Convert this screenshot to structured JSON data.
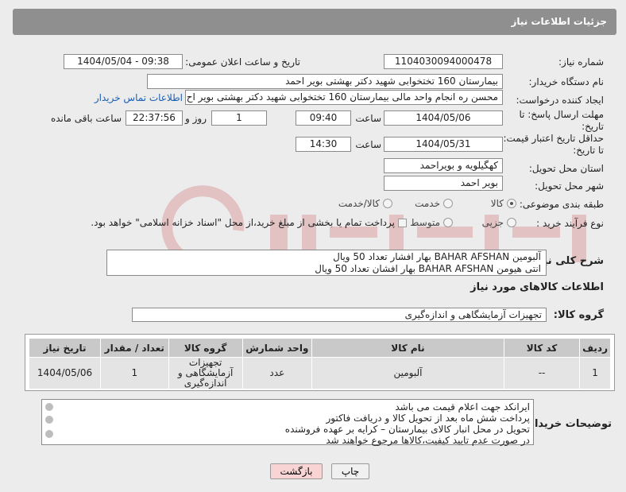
{
  "header": {
    "title": "جزئیات اطلاعات نیاز"
  },
  "labels": {
    "need_number": "شماره نیاز:",
    "announce_datetime": "تاریخ و ساعت اعلان عمومی:",
    "buyer_org": "نام دستگاه خریدار:",
    "requester": "ایجاد کننده درخواست:",
    "reply_deadline_1": "مهلت ارسال پاسخ: تا",
    "reply_deadline_2": "تاریخ:",
    "price_validity_1": "حداقل تاریخ اعتبار قیمت:",
    "price_validity_2": "تا تاریخ:",
    "delivery_province": "استان محل تحویل:",
    "delivery_city": "شهر محل تحویل:",
    "category": "طبقه بندی موضوعی:",
    "purchase_type": "نوع فرآیند خرید :",
    "hour": "ساعت",
    "day_and": "روز و",
    "remaining": "ساعت باقی مانده",
    "hour2": "ساعت"
  },
  "fields": {
    "need_number": "1104030094000478",
    "announce_datetime": "1404/05/04 - 09:38",
    "buyer_org": "بیمارستان 160 تختخوابی شهید دکتر بهشتی بویر احمد",
    "requester": "محسن ره انجام واحد مالی بیمارستان 160 تختخوابی شهید دکتر بهشتی بویر اح",
    "reply_date": "1404/05/06",
    "reply_time": "09:40",
    "reply_days": "1",
    "reply_remaining": "22:37:56",
    "validity_date": "1404/05/31",
    "validity_time": "14:30",
    "province": "کهگیلویه و بویراحمد",
    "city": "بویر احمد"
  },
  "contact_link": "اطلاعات تماس خریدار",
  "category_options": [
    {
      "label": "کالا",
      "selected": true
    },
    {
      "label": "خدمت",
      "selected": false
    },
    {
      "label": "کالا/خدمت",
      "selected": false
    }
  ],
  "purchase_options": [
    {
      "label": "جزیی",
      "selected": false
    },
    {
      "label": "متوسط",
      "selected": false
    }
  ],
  "purchase_note": "پرداخت تمام یا بخشی از مبلغ خرید،از محل \"اسناد خزانه اسلامی\" خواهد بود.",
  "description": {
    "label": "شرح کلی نیاز:",
    "line1": "آلبومین  BAHAR AFSHAN بهار افشار  تعداد 50 ویال",
    "line2": "انتی هیومن  BAHAR AFSHAN بهار افشان تعداد 50 ویال"
  },
  "goods_info_title": "اطلاعات کالاهای مورد نیاز",
  "goods_group": {
    "label": "گروه کالا:",
    "value": "تجهیزات آزمایشگاهی و اندازه‌گیری"
  },
  "table": {
    "headers": [
      "ردیف",
      "کد کالا",
      "نام کالا",
      "واحد شمارش",
      "گروه کالا",
      "تعداد / مقدار",
      "تاریخ نیاز"
    ],
    "rows": [
      {
        "row": "1",
        "code": "--",
        "name": "آلبومین",
        "unit": "عدد",
        "group_l1": "تجهیزات",
        "group_l2": "آزمایشگاهی و",
        "group_l3": "اندازه‌گیری",
        "qty": "1",
        "date": "1404/05/06"
      }
    ]
  },
  "buyer_notes": {
    "label": "توضیحات خریدار:",
    "lines": [
      "ایرانکد جهت اعلام قیمت می باشد",
      "پرداخت شش ماه بعد از تحویل کالا و دریافت فاکتور",
      "تحویل در محل انبار کالای بیمارستان – کرایه بر عهده فروشنده",
      "در صورت عدم تایید کیفیت،کالاها مرجوع خواهند شد"
    ]
  },
  "buttons": {
    "print": "چاپ",
    "back": "بازگشت"
  },
  "colors": {
    "header_bg": "#8f8f8f",
    "link": "#1a5fb4",
    "back_btn_bg": "#f8d4d4",
    "table_header": "#c9c9c9"
  }
}
